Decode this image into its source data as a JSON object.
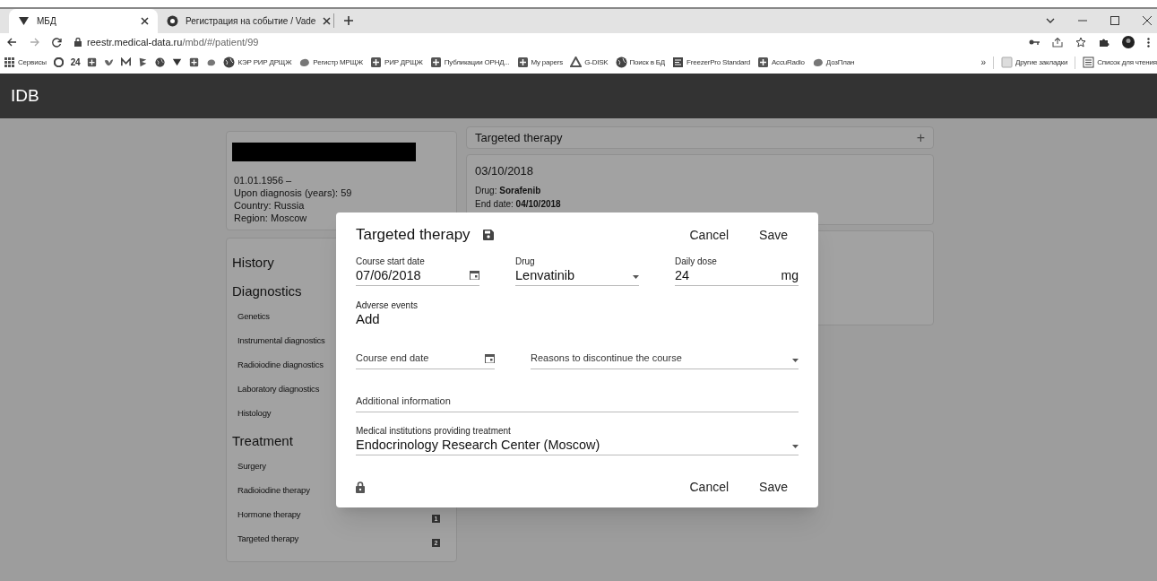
{
  "browser": {
    "tabs": [
      {
        "title": "МБД",
        "selected": true
      },
      {
        "title": "Регистрация на событие / Vade",
        "selected": false
      }
    ],
    "url_host": "reestr.medical-data.ru",
    "url_path": "/mbd/#/patient/99",
    "bookmarks": [
      {
        "kind": "link",
        "label": "Сервисы"
      },
      {
        "kind": "icon"
      },
      {
        "kind": "text",
        "label": "24"
      },
      {
        "kind": "icon"
      },
      {
        "kind": "icon"
      },
      {
        "kind": "icon"
      },
      {
        "kind": "icon"
      },
      {
        "kind": "icon"
      },
      {
        "kind": "icon"
      },
      {
        "kind": "icon"
      },
      {
        "kind": "icon"
      },
      {
        "kind": "link",
        "label": "КЭР РИР ДРЩЖ"
      },
      {
        "kind": "link",
        "label": "Регистр МРЩЖ"
      },
      {
        "kind": "link",
        "label": "РИР ДРЩЖ"
      },
      {
        "kind": "link",
        "label": "Публикации ОРНД..."
      },
      {
        "kind": "link",
        "label": "My papers"
      },
      {
        "kind": "link",
        "label": "G-DISK"
      },
      {
        "kind": "link",
        "label": "Поиск в БД"
      },
      {
        "kind": "link",
        "label": "FreezerPro Standard"
      },
      {
        "kind": "link",
        "label": "AccuRadio"
      },
      {
        "kind": "link",
        "label": "ДозПлан"
      }
    ],
    "bookmarks_more": "»",
    "bookmarks_right": [
      {
        "label": "Другие закладки"
      },
      {
        "label": "Список для чтения"
      }
    ]
  },
  "app": {
    "title": "IDB"
  },
  "patient": {
    "lines": [
      "01.01.1956 –",
      "Upon diagnosis (years): 59",
      "Country: Russia",
      "Region: Moscow"
    ]
  },
  "nav": [
    {
      "kind": "section",
      "label": "History"
    },
    {
      "kind": "section",
      "label": "Diagnostics"
    },
    {
      "kind": "item",
      "label": "Genetics"
    },
    {
      "kind": "item",
      "label": "Instrumental diagnostics"
    },
    {
      "kind": "item",
      "label": "Radioiodine diagnostics"
    },
    {
      "kind": "item",
      "label": "Laboratory diagnostics"
    },
    {
      "kind": "item",
      "label": "Histology"
    },
    {
      "kind": "section",
      "label": "Treatment"
    },
    {
      "kind": "item",
      "label": "Surgery"
    },
    {
      "kind": "item",
      "label": "Radioiodine therapy"
    },
    {
      "kind": "item",
      "label": "Hormone therapy",
      "count": "1"
    },
    {
      "kind": "item",
      "label": "Targeted therapy",
      "count": "2"
    }
  ],
  "section": {
    "title": "Targeted therapy",
    "add": "+",
    "entries": [
      {
        "date": "03/10/2018",
        "lines": [
          "Drug: **Sorafenib**",
          "End date: **04/10/2018**"
        ]
      }
    ]
  },
  "dialog": {
    "title": "Targeted therapy",
    "cancel": "Cancel",
    "save": "Save",
    "rows": [
      [
        {
          "kind": "date",
          "label": "Course start date",
          "value": "07/06/2018"
        },
        {
          "kind": "select",
          "label": "Drug",
          "value": "Lenvatinib"
        },
        {
          "kind": "number",
          "label": "Daily dose",
          "value": "24",
          "unit": "mg"
        }
      ],
      [
        {
          "kind": "link",
          "label": "Adverse events",
          "value": "Add"
        }
      ],
      [
        {
          "kind": "date",
          "placeholder": "Course end date"
        },
        {
          "kind": "select",
          "placeholder": "Reasons to discontinue the course"
        }
      ],
      [
        {
          "kind": "text",
          "placeholder": "Additional information"
        }
      ],
      [
        {
          "kind": "select",
          "label": "Medical institutions providing treatment",
          "value": "Endocrinology Research Center (Moscow)"
        }
      ]
    ],
    "footer_cancel": "Cancel",
    "footer_save": "Save"
  }
}
